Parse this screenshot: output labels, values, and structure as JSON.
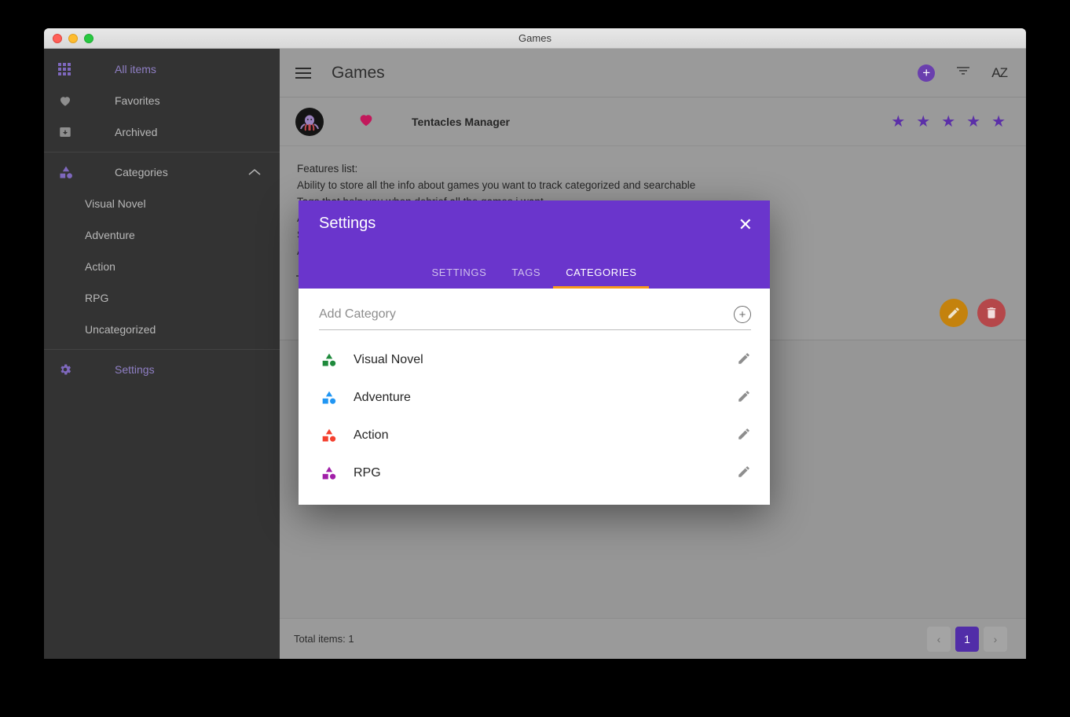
{
  "window": {
    "title": "Games",
    "traffic_lights": [
      "close-button",
      "minimize-button",
      "zoom-button"
    ]
  },
  "sidebar": {
    "items": [
      {
        "label": "All items",
        "icon": "grid-icon",
        "accent": true
      },
      {
        "label": "Favorites",
        "icon": "heart-icon",
        "accent": false
      },
      {
        "label": "Archived",
        "icon": "archive-icon",
        "accent": false
      },
      {
        "label": "Categories",
        "icon": "shapes-icon",
        "accent": false,
        "expanded": true,
        "chevron": "chevron-up-icon"
      }
    ],
    "categories": [
      {
        "label": "Visual Novel"
      },
      {
        "label": "Adventure"
      },
      {
        "label": "Action"
      },
      {
        "label": "RPG"
      },
      {
        "label": "Uncategorized"
      }
    ],
    "settings": {
      "label": "Settings",
      "icon": "gear-icon"
    }
  },
  "header": {
    "menu_icon": "hamburger-icon",
    "title": "Games",
    "add_label": "+",
    "filter_icon": "filter-icon",
    "sort_label": "AZ"
  },
  "item": {
    "name": "Tentacles Manager",
    "favorite_icon": "heart-icon",
    "avatar_icon": "octopus-avatar",
    "rating": 5,
    "star_glyph": "★"
  },
  "description": {
    "lines": [
      "Features list:",
      "Ability to store all the info about games you want to track categorized and searchable",
      "Tags that help you when debrief all the games i want",
      "A",
      "S",
      "A                                                                                                                   outer"
    ]
  },
  "actions": {
    "edit_label": "✎",
    "delete_label": "🗑",
    "collapse_icon": "collapse-icon"
  },
  "footer": {
    "total_items": "Total items: 1",
    "prev_label": "‹",
    "next_label": "›",
    "current_page": "1"
  },
  "modal": {
    "title": "Settings",
    "close_label": "✕",
    "tabs": [
      {
        "label": "SETTINGS",
        "active": false
      },
      {
        "label": "TAGS",
        "active": false
      },
      {
        "label": "CATEGORIES",
        "active": true
      }
    ],
    "add_category": {
      "placeholder": "Add Category",
      "value": "",
      "add_label": "+"
    },
    "categories": [
      {
        "label": "Visual Novel",
        "color": "#1f8a3c"
      },
      {
        "label": "Adventure",
        "color": "#2196f3"
      },
      {
        "label": "Action",
        "color": "#f4402f"
      },
      {
        "label": "RPG",
        "color": "#a11fa8"
      }
    ],
    "edit_icon": "pencil-icon"
  },
  "colors": {
    "modal_header": "#6a35cc",
    "tab_underline": "#f79a1e",
    "accent_purple": "#6a3fae",
    "edit_fab": "#c4820d",
    "delete_fab": "#b5474a",
    "star": "#5b2fa8",
    "heart": "#c2185b",
    "page_active": "#512da8"
  }
}
